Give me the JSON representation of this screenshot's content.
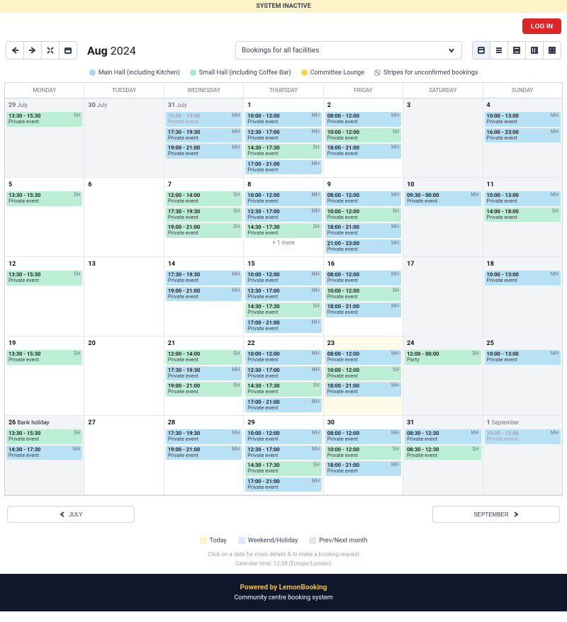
{
  "banner": "SYSTEM INACTIVE",
  "login": "LOG IN",
  "month": "Aug",
  "year": "2024",
  "dropdown": "Bookings for all facilities",
  "dow": [
    "MONDAY",
    "TUESDAY",
    "WEDNESDAY",
    "THURSDAY",
    "FRIDAY",
    "SATURDAY",
    "SUNDAY"
  ],
  "legend": {
    "mh": "Main Hall (including Kitchen)",
    "sh": "Small Hall (including Coffee Bar)",
    "cl": "Committee Lounge",
    "str": "Stripes for unconfirmed bookings"
  },
  "legend2": {
    "today": "Today",
    "wk": "Weekend/Holiday",
    "pn": "Prev/Next month"
  },
  "prev": "JULY",
  "next": "SEPTEMBER",
  "hint1": "Click on a date for more details & to make a booking request",
  "hint2": "Calendar time: 12:38 (Europe/London)",
  "footer1": "Powered by LemonBooking",
  "footer2": "Community centre booking system",
  "pe": "Private event",
  "party": "Party",
  "more": "+ 1 more",
  "weeks": [
    {
      "days": [
        {
          "n": "29",
          "suf": "July",
          "cls": "prevnext dim",
          "ev": [
            {
              "t": "13:30 - 15:30",
              "f": "SH"
            }
          ]
        },
        {
          "n": "30",
          "suf": "July",
          "cls": "prevnext dim",
          "ev": []
        },
        {
          "n": "31",
          "suf": "July",
          "cls": "prevnext dim",
          "ev": [
            {
              "t": "10:00 - 13:00",
              "f": "MH",
              "dim": true
            },
            {
              "t": "17:30 - 19:30",
              "f": "MH"
            },
            {
              "t": "19:00 - 21:00",
              "f": "MH"
            }
          ]
        },
        {
          "n": "1",
          "cls": "",
          "ev": [
            {
              "t": "10:00 - 12:00",
              "f": "MH"
            },
            {
              "t": "12:30 - 17:00",
              "f": "MH"
            },
            {
              "t": "14:30 - 17:30",
              "f": "SH"
            },
            {
              "t": "17:00 - 21:00",
              "f": "MH"
            }
          ]
        },
        {
          "n": "2",
          "cls": "",
          "ev": [
            {
              "t": "08:00 - 12:00",
              "f": "MH"
            },
            {
              "t": "10:00 - 12:00",
              "f": "SH"
            },
            {
              "t": "18:00 - 21:00",
              "f": "MH"
            }
          ]
        },
        {
          "n": "3",
          "cls": "weekend",
          "ev": []
        },
        {
          "n": "4",
          "cls": "weekend",
          "ev": [
            {
              "t": "10:00 - 13:00",
              "f": "MH"
            },
            {
              "t": "16:00 - 23:00",
              "f": "MH"
            }
          ]
        }
      ]
    },
    {
      "days": [
        {
          "n": "5",
          "cls": "",
          "ev": [
            {
              "t": "13:30 - 15:30",
              "f": "SH"
            }
          ]
        },
        {
          "n": "6",
          "cls": "",
          "ev": []
        },
        {
          "n": "7",
          "cls": "",
          "ev": [
            {
              "t": "12:00 - 14:00",
              "f": "SH"
            },
            {
              "t": "17:30 - 19:30",
              "f": "SH"
            },
            {
              "t": "19:00 - 21:00",
              "f": "SH"
            }
          ]
        },
        {
          "n": "8",
          "cls": "",
          "ev": [
            {
              "t": "10:00 - 12:00",
              "f": "MH"
            },
            {
              "t": "12:30 - 17:00",
              "f": "MH"
            },
            {
              "t": "14:30 - 17:30",
              "f": "SH"
            }
          ],
          "more": true
        },
        {
          "n": "9",
          "cls": "",
          "ev": [
            {
              "t": "08:00 - 12:00",
              "f": "MH"
            },
            {
              "t": "10:00 - 12:00",
              "f": "SH"
            },
            {
              "t": "18:00 - 21:00",
              "f": "MH"
            },
            {
              "t": "21:00 - 23:00",
              "f": "MH"
            }
          ]
        },
        {
          "n": "10",
          "cls": "weekend",
          "ev": [
            {
              "t": "09:30 - 00:00",
              "f": "MH"
            }
          ]
        },
        {
          "n": "11",
          "cls": "weekend",
          "ev": [
            {
              "t": "10:00 - 13:00",
              "f": "MH"
            },
            {
              "t": "14:00 - 18:00",
              "f": "SH"
            }
          ]
        }
      ]
    },
    {
      "days": [
        {
          "n": "12",
          "cls": "",
          "ev": [
            {
              "t": "13:30 - 15:30",
              "f": "SH"
            }
          ]
        },
        {
          "n": "13",
          "cls": "",
          "ev": []
        },
        {
          "n": "14",
          "cls": "",
          "ev": [
            {
              "t": "17:30 - 19:30",
              "f": "MH"
            },
            {
              "t": "19:00 - 21:00",
              "f": "MH"
            }
          ]
        },
        {
          "n": "15",
          "cls": "",
          "ev": [
            {
              "t": "10:00 - 12:00",
              "f": "MH"
            },
            {
              "t": "12:30 - 17:00",
              "f": "MH"
            },
            {
              "t": "14:30 - 17:30",
              "f": "SH"
            },
            {
              "t": "17:00 - 21:00",
              "f": "MH"
            }
          ]
        },
        {
          "n": "16",
          "cls": "",
          "ev": [
            {
              "t": "08:00 - 12:00",
              "f": "MH"
            },
            {
              "t": "10:00 - 12:00",
              "f": "SH"
            },
            {
              "t": "18:00 - 21:00",
              "f": "MH"
            }
          ]
        },
        {
          "n": "17",
          "cls": "weekend",
          "ev": []
        },
        {
          "n": "18",
          "cls": "weekend",
          "ev": [
            {
              "t": "10:00 - 13:00",
              "f": "MH"
            }
          ]
        }
      ]
    },
    {
      "days": [
        {
          "n": "19",
          "cls": "",
          "ev": [
            {
              "t": "13:30 - 15:30",
              "f": "SH"
            }
          ]
        },
        {
          "n": "20",
          "cls": "",
          "ev": []
        },
        {
          "n": "21",
          "cls": "",
          "ev": [
            {
              "t": "12:00 - 14:00",
              "f": "SH"
            },
            {
              "t": "17:30 - 19:30",
              "f": "MH"
            },
            {
              "t": "19:00 - 21:00",
              "f": "SH"
            }
          ]
        },
        {
          "n": "22",
          "cls": "",
          "ev": [
            {
              "t": "10:00 - 12:00",
              "f": "MH"
            },
            {
              "t": "12:30 - 17:00",
              "f": "MH"
            },
            {
              "t": "14:30 - 17:30",
              "f": "SH"
            },
            {
              "t": "17:00 - 21:00",
              "f": "MH"
            }
          ]
        },
        {
          "n": "23",
          "cls": "highlight",
          "ev": [
            {
              "t": "08:00 - 12:00",
              "f": "MH"
            },
            {
              "t": "10:00 - 12:00",
              "f": "SH"
            },
            {
              "t": "18:00 - 21:00",
              "f": "MH"
            }
          ]
        },
        {
          "n": "24",
          "cls": "weekend",
          "ev": [
            {
              "t": "12:00 - 00:00",
              "f": "SH",
              "lbl": "party"
            }
          ]
        },
        {
          "n": "25",
          "cls": "weekend",
          "ev": [
            {
              "t": "10:00 - 13:00",
              "f": "MH"
            }
          ]
        }
      ]
    },
    {
      "days": [
        {
          "n": "26",
          "suf": "Bank holiday",
          "cls": "weekend",
          "ev": [
            {
              "t": "13:30 - 15:30",
              "f": "SH"
            },
            {
              "t": "14:30 - 17:30",
              "f": "MH"
            }
          ]
        },
        {
          "n": "27",
          "cls": "",
          "ev": []
        },
        {
          "n": "28",
          "cls": "",
          "ev": [
            {
              "t": "17:30 - 19:30",
              "f": "MH"
            },
            {
              "t": "19:00 - 21:00",
              "f": "MH"
            }
          ]
        },
        {
          "n": "29",
          "cls": "",
          "ev": [
            {
              "t": "10:00 - 12:00",
              "f": "MH"
            },
            {
              "t": "12:30 - 17:00",
              "f": "MH"
            },
            {
              "t": "14:30 - 17:30",
              "f": "SH"
            },
            {
              "t": "17:00 - 21:00",
              "f": "MH"
            }
          ]
        },
        {
          "n": "30",
          "cls": "",
          "ev": [
            {
              "t": "08:00 - 12:00",
              "f": "MH"
            },
            {
              "t": "10:00 - 12:00",
              "f": "SH"
            },
            {
              "t": "18:00 - 21:00",
              "f": "MH"
            }
          ]
        },
        {
          "n": "31",
          "cls": "weekend",
          "ev": [
            {
              "t": "08:30 - 12:30",
              "f": "MH"
            },
            {
              "t": "08:30 - 12:30",
              "f": "SH"
            }
          ]
        },
        {
          "n": "1",
          "suf": "September",
          "cls": "prevnext dim",
          "ev": [
            {
              "t": "10:00 - 13:00",
              "f": "MH",
              "dim": true
            }
          ]
        }
      ]
    }
  ]
}
